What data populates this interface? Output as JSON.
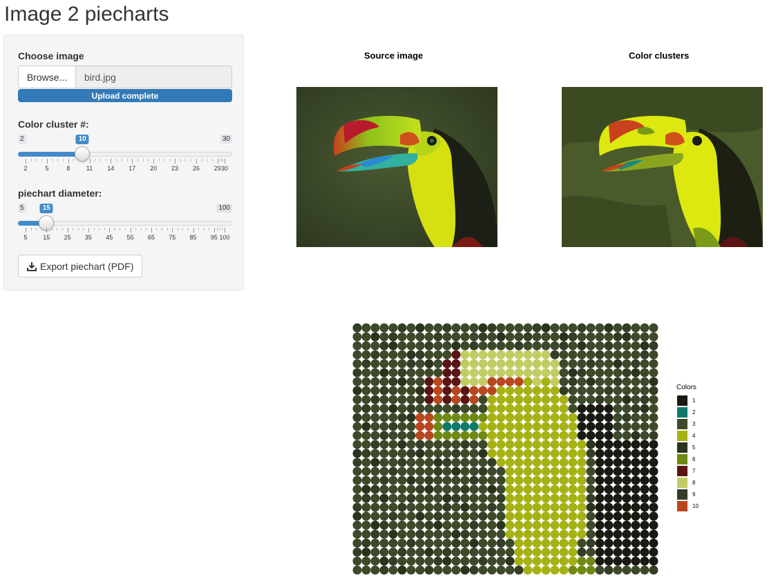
{
  "app": {
    "title": "Image 2 piecharts"
  },
  "sidebar": {
    "choose_image_label": "Choose image",
    "browse_label": "Browse...",
    "file_name": "bird.jpg",
    "upload_status": "Upload complete",
    "cluster_label": "Color cluster #:",
    "cluster_slider": {
      "min": 2,
      "max": 30,
      "value": 10,
      "min_label": "2",
      "max_label": "30",
      "value_label": "10",
      "tick_labels": [
        "2",
        "5",
        "8",
        "11",
        "14",
        "17",
        "20",
        "23",
        "26",
        "29",
        "30"
      ],
      "tick_values": [
        2,
        5,
        8,
        11,
        14,
        17,
        20,
        23,
        26,
        29,
        30
      ]
    },
    "diameter_label": "piechart diameter:",
    "diameter_slider": {
      "min": 5,
      "max": 100,
      "value": 15,
      "min_label": "5",
      "max_label": "100",
      "value_label": "15",
      "tick_labels": [
        "5",
        "15",
        "25",
        "35",
        "45",
        "55",
        "65",
        "75",
        "85",
        "95",
        "100"
      ],
      "tick_values": [
        5,
        15,
        25,
        35,
        45,
        55,
        65,
        75,
        85,
        95,
        100
      ]
    },
    "export_label": "Export piechart (PDF)",
    "export_icon": "download-icon"
  },
  "plots": {
    "source_title": "Source image",
    "clusters_title": "Color clusters"
  },
  "legend": {
    "title": "Colors",
    "items": [
      {
        "label": "1",
        "color": "#1a1a12"
      },
      {
        "label": "2",
        "color": "#0f7a6c"
      },
      {
        "label": "3",
        "color": "#3d4a2a"
      },
      {
        "label": "4",
        "color": "#a6b214"
      },
      {
        "label": "5",
        "color": "#2a331c"
      },
      {
        "label": "6",
        "color": "#6e8a14"
      },
      {
        "label": "7",
        "color": "#5a1414"
      },
      {
        "label": "8",
        "color": "#c2cc63"
      },
      {
        "label": "9",
        "color": "#343d25"
      },
      {
        "label": "10",
        "color": "#b8461e"
      }
    ]
  }
}
